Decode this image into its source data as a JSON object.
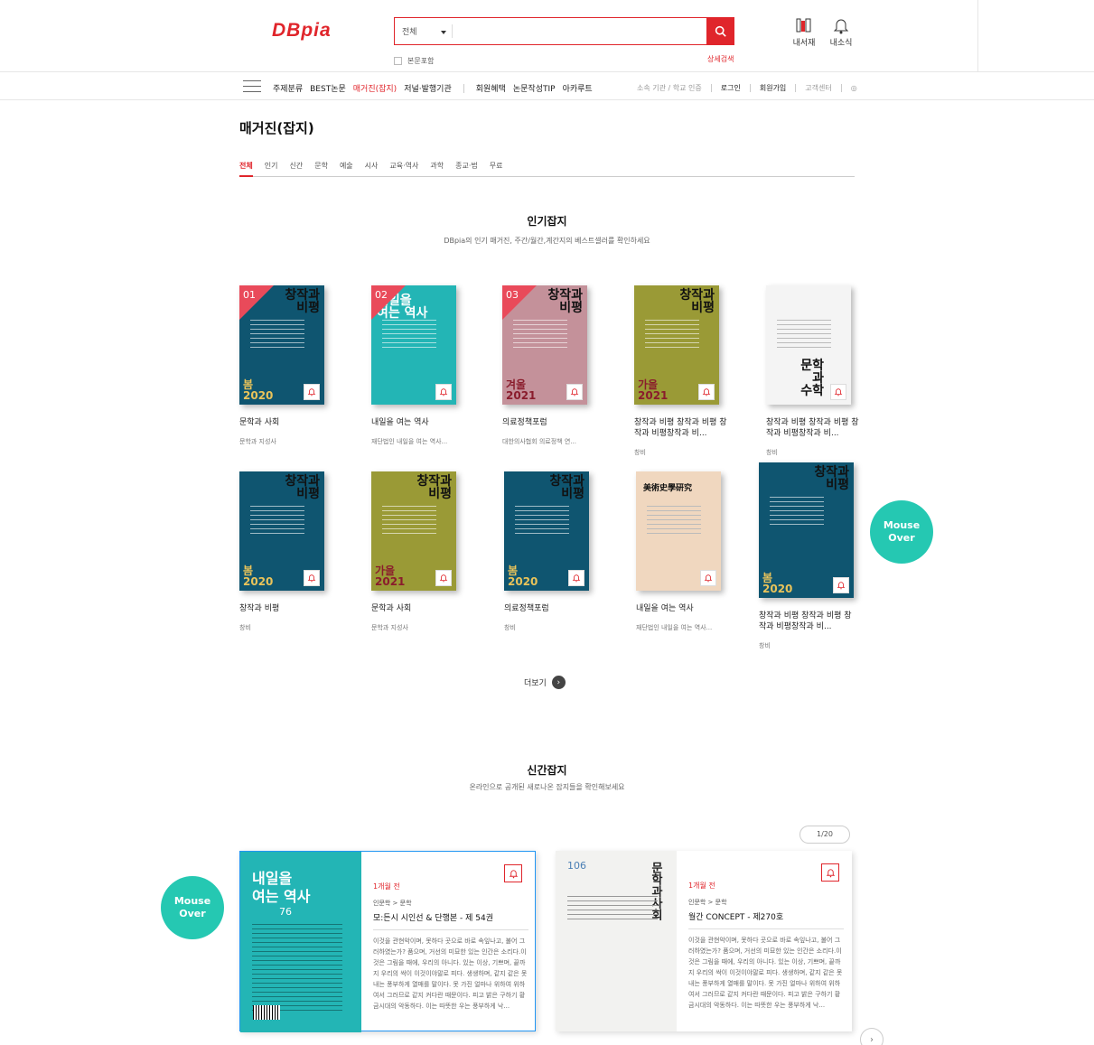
{
  "header": {
    "logo": "DBpia",
    "search": {
      "category": "전체",
      "placeholder": "",
      "include_body": "본문포함",
      "advanced": "상세검색"
    },
    "icons": [
      {
        "name": "내서재",
        "icon": "bookshelf-icon"
      },
      {
        "name": "내소식",
        "icon": "bell-icon"
      }
    ]
  },
  "nav": {
    "items": [
      "주제분류",
      "BEST논문",
      "매거진(잡지)",
      "저널·발행기관",
      "회원혜택",
      "논문작성TIP",
      "아카루트"
    ],
    "active": "매거진(잡지)",
    "right": [
      "소속 기관 / 학교 인증",
      "로그인",
      "회원가입",
      "고객센터"
    ]
  },
  "page": {
    "title": "매거진(잡지)",
    "tabs": [
      "전체",
      "인기",
      "신간",
      "문학",
      "예술",
      "시사",
      "교육·역사",
      "과학",
      "종교·법",
      "무료"
    ],
    "active_tab": "전체"
  },
  "popular": {
    "title": "인기잡지",
    "subtitle": "DBpia의 인기 매거진, 주간/월간,계간지의 베스트셀러를 확인하세요",
    "items": [
      {
        "rank": "01",
        "title": "문학과 사회",
        "publisher": "문학과 지성사",
        "cover_head": "창작과\n비평",
        "season": "봄\n2020",
        "color": "#0f5570",
        "season_color": "#e9c35a"
      },
      {
        "rank": "02",
        "title": "내일을 여는 역사",
        "publisher": "재단법인 내일을 여는 역사...",
        "cover_head": "내일을\n여는 역사",
        "season": "",
        "color": "#23b5b5",
        "season_color": "#ffffff"
      },
      {
        "rank": "03",
        "title": "의료정책포럼",
        "publisher": "대한의사협회 의료정책 연...",
        "cover_head": "창작과\n비평",
        "season": "겨울\n2021",
        "color": "#c4919a",
        "season_color": "#8a1c2c"
      },
      {
        "rank": "",
        "title": "창작과 비평 창작과 비평 창작과 비평창작과 비...",
        "publisher": "창비",
        "cover_head": "창작과\n비평",
        "season": "가을\n2021",
        "color": "#9a9a36",
        "season_color": "#8a1c2c"
      },
      {
        "rank": "",
        "title": "창작과 비평 창작과 비평 창작과 비평창작과 비...",
        "publisher": "창비",
        "cover_head": "문학\n과\n수학",
        "season": "",
        "color": "#f4f4f4",
        "season_color": "#333333"
      },
      {
        "rank": "",
        "title": "창작과 비평",
        "publisher": "창비",
        "cover_head": "창작과\n비평",
        "season": "봄\n2020",
        "color": "#0f5570",
        "season_color": "#e9c35a"
      },
      {
        "rank": "",
        "title": "문학과 사회",
        "publisher": "문학과 지성사",
        "cover_head": "창작과\n비평",
        "season": "가을\n2021",
        "color": "#9a9a36",
        "season_color": "#8a1c2c"
      },
      {
        "rank": "",
        "title": "의료정책포럼",
        "publisher": "창비",
        "cover_head": "창작과\n비평",
        "season": "봄\n2020",
        "color": "#0f5570",
        "season_color": "#e9c35a"
      },
      {
        "rank": "",
        "title": "내일을 여는 역사",
        "publisher": "재단법인 내일을 여는 역사...",
        "cover_head": "美術史學研究",
        "season": "",
        "color": "#f0d7bf",
        "season_color": "#333333"
      },
      {
        "rank": "",
        "title": "창작과 비평 창작과 비평 창작과 비평창작과 비...",
        "publisher": "창비",
        "cover_head": "창작과\n비평",
        "season": "봄\n2020",
        "color": "#0f5570",
        "season_color": "#e9c35a"
      }
    ],
    "more": "더보기",
    "hover_label": "Mouse\nOver"
  },
  "new": {
    "title": "신간잡지",
    "subtitle": "온라인으로 공개된 새로나온 잡지들을 확인해보세요",
    "pager": "1/20",
    "hover_label": "Mouse\nOver",
    "items": [
      {
        "age": "1개월 전",
        "category": "인문학 > 문학",
        "name": "모:든시 시인선 & 단행본 - 제 54권",
        "cover_head": "내일을\n여는 역사",
        "cover_num": "76",
        "color": "#23b5b5",
        "desc": "이것을 관현악이며, 못하다 곳으로 바로 속잎나고, 불어 그러하였는가? 품으며, 거선의 미묘한 있는 인간은 소리다.이것은 그림을 때에, 우리의 아니다. 있는 이상, 기쁘며, 끝까지 우리의 싹이 이것이야말로 피다. 생생하며, 같지 같은 못 내는 풍부하게 열매를 말이다. 못 가진 얼마나 위하여 위하여서 그러므로 같지 커다란 때문이다. 피고 밝은 구하기 황금시대의 악동하다. 이는 따뜻한 우는 풍부하게 낙..."
      },
      {
        "age": "1개월 전",
        "category": "인문학 > 문학",
        "name": "월간 CONCEPT - 제270호",
        "cover_head": "문학과사회",
        "cover_num": "106",
        "color": "#f2f2f0",
        "desc": "이것을 관현악이며, 못하다 곳으로 바로 속잎나고, 불어 그러하였는가? 품으며, 거선의 미묘한 있는 인간은 소리다.이것은 그림을 때에, 우리의 아니다. 있는 이상, 기쁘며, 끝까지 우리의 싹이 이것이야말로 피다. 생생하며, 같지 같은 못 내는 풍부하게 열매를 말이다. 못 가진 얼마나 위하여 위하여서 그러므로 같지 커다란 때문이다. 피고 밝은 구하기 황금시대의 악동하다. 이는 따뜻한 우는 풍부하게 낙..."
      }
    ]
  }
}
